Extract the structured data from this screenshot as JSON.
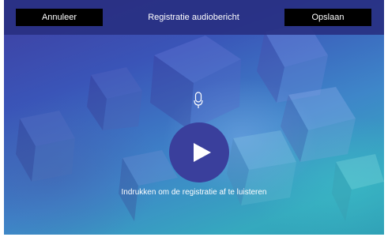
{
  "header": {
    "cancel_label": "Annuleer",
    "title": "Registratie audiobericht",
    "save_label": "Opslaan"
  },
  "main": {
    "mic_icon": "microphone-icon",
    "play_icon": "play-icon",
    "hint": "Indrukken om de registratie af te luisteren"
  },
  "colors": {
    "header_bg": "#283082",
    "button_bg": "#000000",
    "play_button_bg": "#3a3f9c",
    "text": "#ffffff"
  }
}
